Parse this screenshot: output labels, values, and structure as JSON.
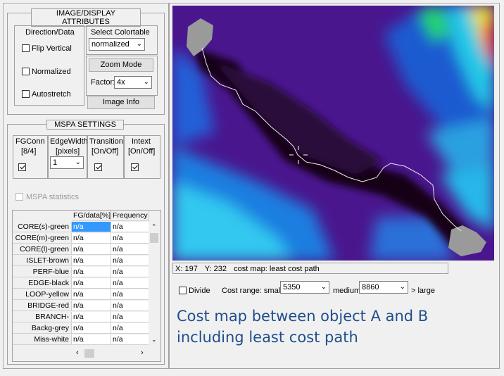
{
  "image_display": {
    "title": "IMAGE/DISPLAY ATTRIBUTES",
    "direction_title": "Direction/Data",
    "flip_vertical": "Flip Vertical",
    "normalized": "Normalized",
    "autostretch": "Autostretch",
    "colortable_label": "Select Colortable",
    "colortable_value": "normalized",
    "zoom_mode": "Zoom Mode",
    "factor_label": "Factor:",
    "factor_value": "4x",
    "image_info": "Image Info"
  },
  "mspa": {
    "title": "MSPA SETTINGS",
    "fgconn": "FGConn",
    "fgconn_sub": "[8/4]",
    "edgewidth": "EdgeWidth",
    "edgewidth_sub": "[pixels]",
    "edgewidth_value": "1",
    "transition": "Transition",
    "transition_sub": "[On/Off]",
    "intext": "Intext",
    "intext_sub": "[On/Off]",
    "statistics": "MSPA statistics"
  },
  "table": {
    "columns": [
      "FG/data[%]",
      "Frequency"
    ],
    "rows": [
      {
        "label": "CORE(s)-green",
        "fg": "n/a",
        "freq": "n/a"
      },
      {
        "label": "CORE(m)-green",
        "fg": "n/a",
        "freq": "n/a"
      },
      {
        "label": "CORE(l)-green",
        "fg": "n/a",
        "freq": "n/a"
      },
      {
        "label": "ISLET-brown",
        "fg": "n/a",
        "freq": "n/a"
      },
      {
        "label": "PERF-blue",
        "fg": "n/a",
        "freq": "n/a"
      },
      {
        "label": "EDGE-black",
        "fg": "n/a",
        "freq": "n/a"
      },
      {
        "label": "LOOP-yellow",
        "fg": "n/a",
        "freq": "n/a"
      },
      {
        "label": "BRIDGE-red",
        "fg": "n/a",
        "freq": "n/a"
      },
      {
        "label": "BRANCH-orange",
        "fg": "n/a",
        "freq": "n/a"
      },
      {
        "label": "Backg-grey",
        "fg": "n/a",
        "freq": "n/a"
      },
      {
        "label": "Miss-white",
        "fg": "n/a",
        "freq": "n/a"
      }
    ]
  },
  "status": {
    "x_label": "X:",
    "x_value": "197",
    "y_label": "Y:",
    "y_value": "232",
    "message": "cost map: least cost path"
  },
  "cost": {
    "divide": "Divide",
    "range_label": "Cost range: small <",
    "small_value": "5350",
    "medium_label": "medium",
    "medium_value": "8860",
    "large_label": "> large"
  },
  "caption": {
    "line1": "Cost map between object A and B",
    "line2": "including least cost path",
    "color": "#1f4e8c"
  }
}
